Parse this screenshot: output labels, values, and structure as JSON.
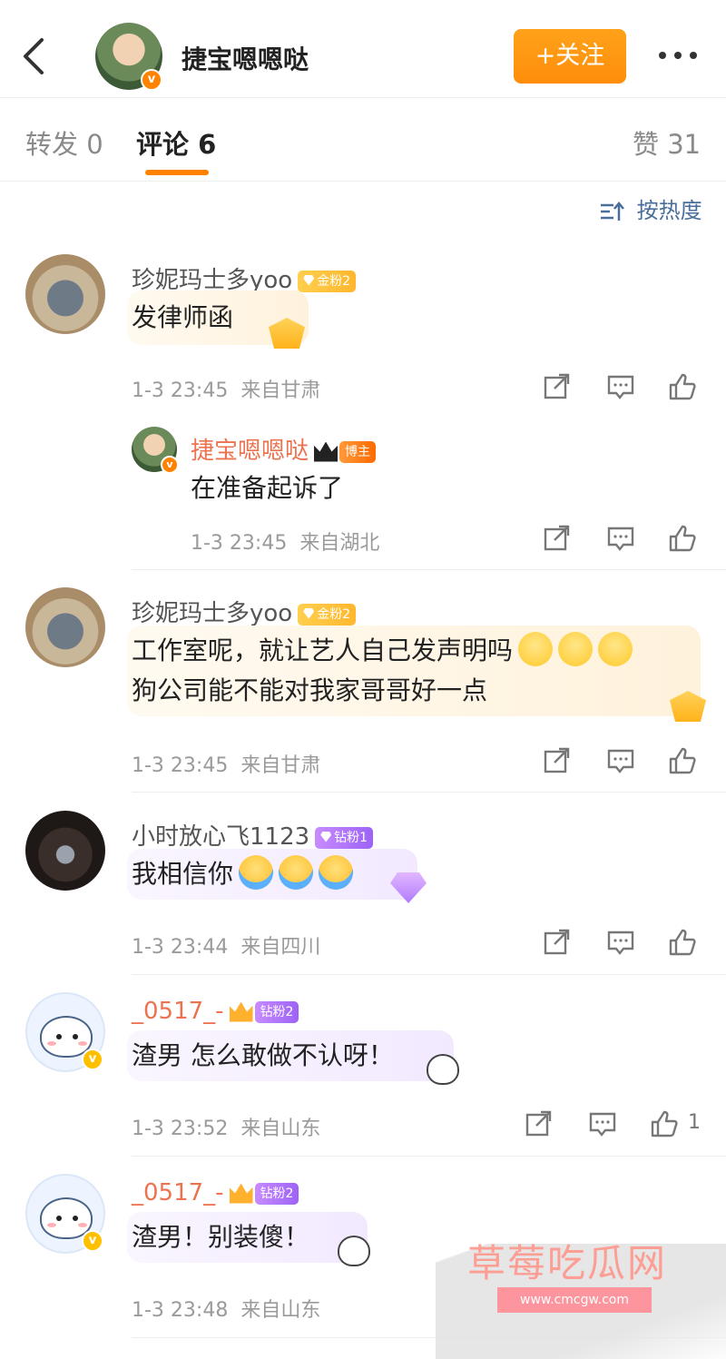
{
  "header": {
    "author_name": "捷宝嗯嗯哒",
    "follow_label": "+关注",
    "verified_icon": "v-badge"
  },
  "tabs": [
    {
      "label": "转发",
      "count": "0"
    },
    {
      "label": "评论",
      "count": "6"
    },
    {
      "label": "赞",
      "count": "31"
    }
  ],
  "sort_label": "按热度",
  "comments": [
    {
      "user": "珍妮玛士多yoo",
      "badge": "金粉2",
      "text": "发律师函",
      "time": "1-3 23:45",
      "location": "来自甘肃",
      "reply": {
        "user": "捷宝嗯嗯哒",
        "badge": "博主",
        "text": "在准备起诉了",
        "time": "1-3 23:45",
        "location": "来自湖北"
      }
    },
    {
      "user": "珍妮玛士多yoo",
      "badge": "金粉2",
      "text_line1": "工作室呢，就让艺人自己发声明吗",
      "text_line2": "狗公司能不能对我家哥哥好一点",
      "time": "1-3 23:45",
      "location": "来自甘肃"
    },
    {
      "user": "小时放心飞1123",
      "badge": "钻粉1",
      "text": "我相信你",
      "time": "1-3 23:44",
      "location": "来自四川"
    },
    {
      "user": "_0517_-",
      "badge": "钻粉2",
      "text": "渣男 怎么敢做不认呀！",
      "time": "1-3 23:52",
      "location": "来自山东",
      "likes": "1"
    },
    {
      "user": "_0517_-",
      "badge": "钻粉2",
      "text": "渣男！别装傻！",
      "time": "1-3 23:48",
      "location": "来自山东"
    }
  ],
  "watermark": {
    "title": "草莓吃瓜网",
    "url": "www.cmcgw.com"
  },
  "colors": {
    "accent": "#ff8200",
    "link_blue": "#4a6e9b",
    "blogger_name": "#eb7350"
  }
}
